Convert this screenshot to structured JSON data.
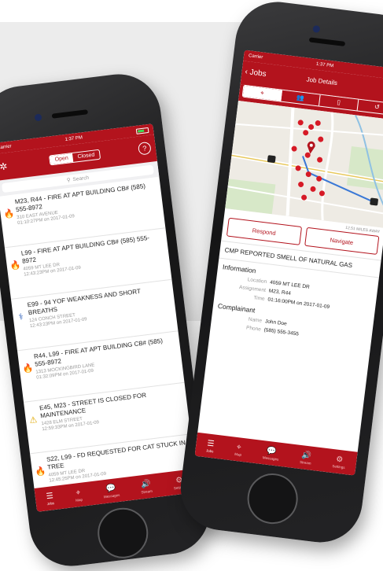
{
  "left_phone": {
    "status": {
      "carrier": "Carrier",
      "time": "1:37 PM"
    },
    "nav": {
      "segment_open": "Open",
      "segment_closed": "Closed"
    },
    "search": {
      "placeholder": "Search"
    },
    "jobs": [
      {
        "icon": "fire-icon",
        "title": "M23, R44 - FIRE AT APT BUILDING CB# (585) 555-8972",
        "address": "310 EAST AVENUE",
        "time": "01:10:27PM on 2017-01-09"
      },
      {
        "icon": "fire-icon",
        "title": "L99 - FIRE AT APT BUILDING CB# (585) 555-8972",
        "address": "4059 MT LEE DR",
        "time": "12:43:23PM on 2017-01-09"
      },
      {
        "icon": "medical-icon",
        "title": "E99 - 94 YOF WEAKNESS AND SHORT BREATHS",
        "address": "124 CONCH STREET",
        "time": "12:43:23PM on 2017-01-09"
      },
      {
        "icon": "fire-icon",
        "title": "R44, L99 - FIRE AT APT BUILDING CB# (585) 555-8972",
        "address": "1313 MOCKINGBIRD LANE",
        "time": "01:32:09PM on 2017-01-09"
      },
      {
        "icon": "warning-icon",
        "title": "E45, M23 - STREET IS CLOSED FOR MAINTENANCE",
        "address": "1428 ELM STREET",
        "time": "12:59:33PM on 2017-01-09"
      },
      {
        "icon": "fire-icon",
        "title": "S22, L99 - FD REQUESTED FOR CAT STUCK IN TREE",
        "address": "4059 MT LEE DR",
        "time": "12:45:25PM on 2017-01-09"
      }
    ],
    "tabs": [
      {
        "label": "Jobs",
        "icon": "list-icon"
      },
      {
        "label": "Map",
        "icon": "map-pin-icon"
      },
      {
        "label": "Messages",
        "icon": "chat-icon"
      },
      {
        "label": "Stream",
        "icon": "audio-icon"
      },
      {
        "label": "Settings",
        "icon": "gear-icon"
      }
    ]
  },
  "right_phone": {
    "status": {
      "carrier": "Carrier",
      "time": "1:37 PM"
    },
    "nav": {
      "back_label": "Jobs",
      "title": "Job Details"
    },
    "segments": [
      "location-pin-icon",
      "people-icon",
      "book-icon",
      "history-icon"
    ],
    "distance": "12.51 MILES AWAY",
    "map_labels": {
      "road1": "Leland",
      "road2": "Lloyd"
    },
    "respond_label": "Respond",
    "navigate_label": "Navigate",
    "description": "CMP REPORTED SMELL OF NATURAL GAS",
    "info_heading": "Information",
    "info": [
      {
        "key": "Location",
        "value": "4059 MT LEE DR"
      },
      {
        "key": "Assignment",
        "value": "M23, R44"
      },
      {
        "key": "Time",
        "value": "01:16:00PM on 2017-01-09"
      }
    ],
    "complainant_heading": "Complainant",
    "complainant": [
      {
        "key": "Name",
        "value": "John Doe"
      },
      {
        "key": "Phone",
        "value": "(585) 555-3455"
      }
    ],
    "tabs": [
      {
        "label": "Jobs",
        "icon": "list-icon"
      },
      {
        "label": "Map",
        "icon": "map-pin-icon"
      },
      {
        "label": "Messages",
        "icon": "chat-icon"
      },
      {
        "label": "Stream",
        "icon": "audio-icon"
      },
      {
        "label": "Settings",
        "icon": "gear-icon"
      }
    ]
  },
  "colors": {
    "brand_red": "#b3131d",
    "background_band": "#ececec"
  }
}
